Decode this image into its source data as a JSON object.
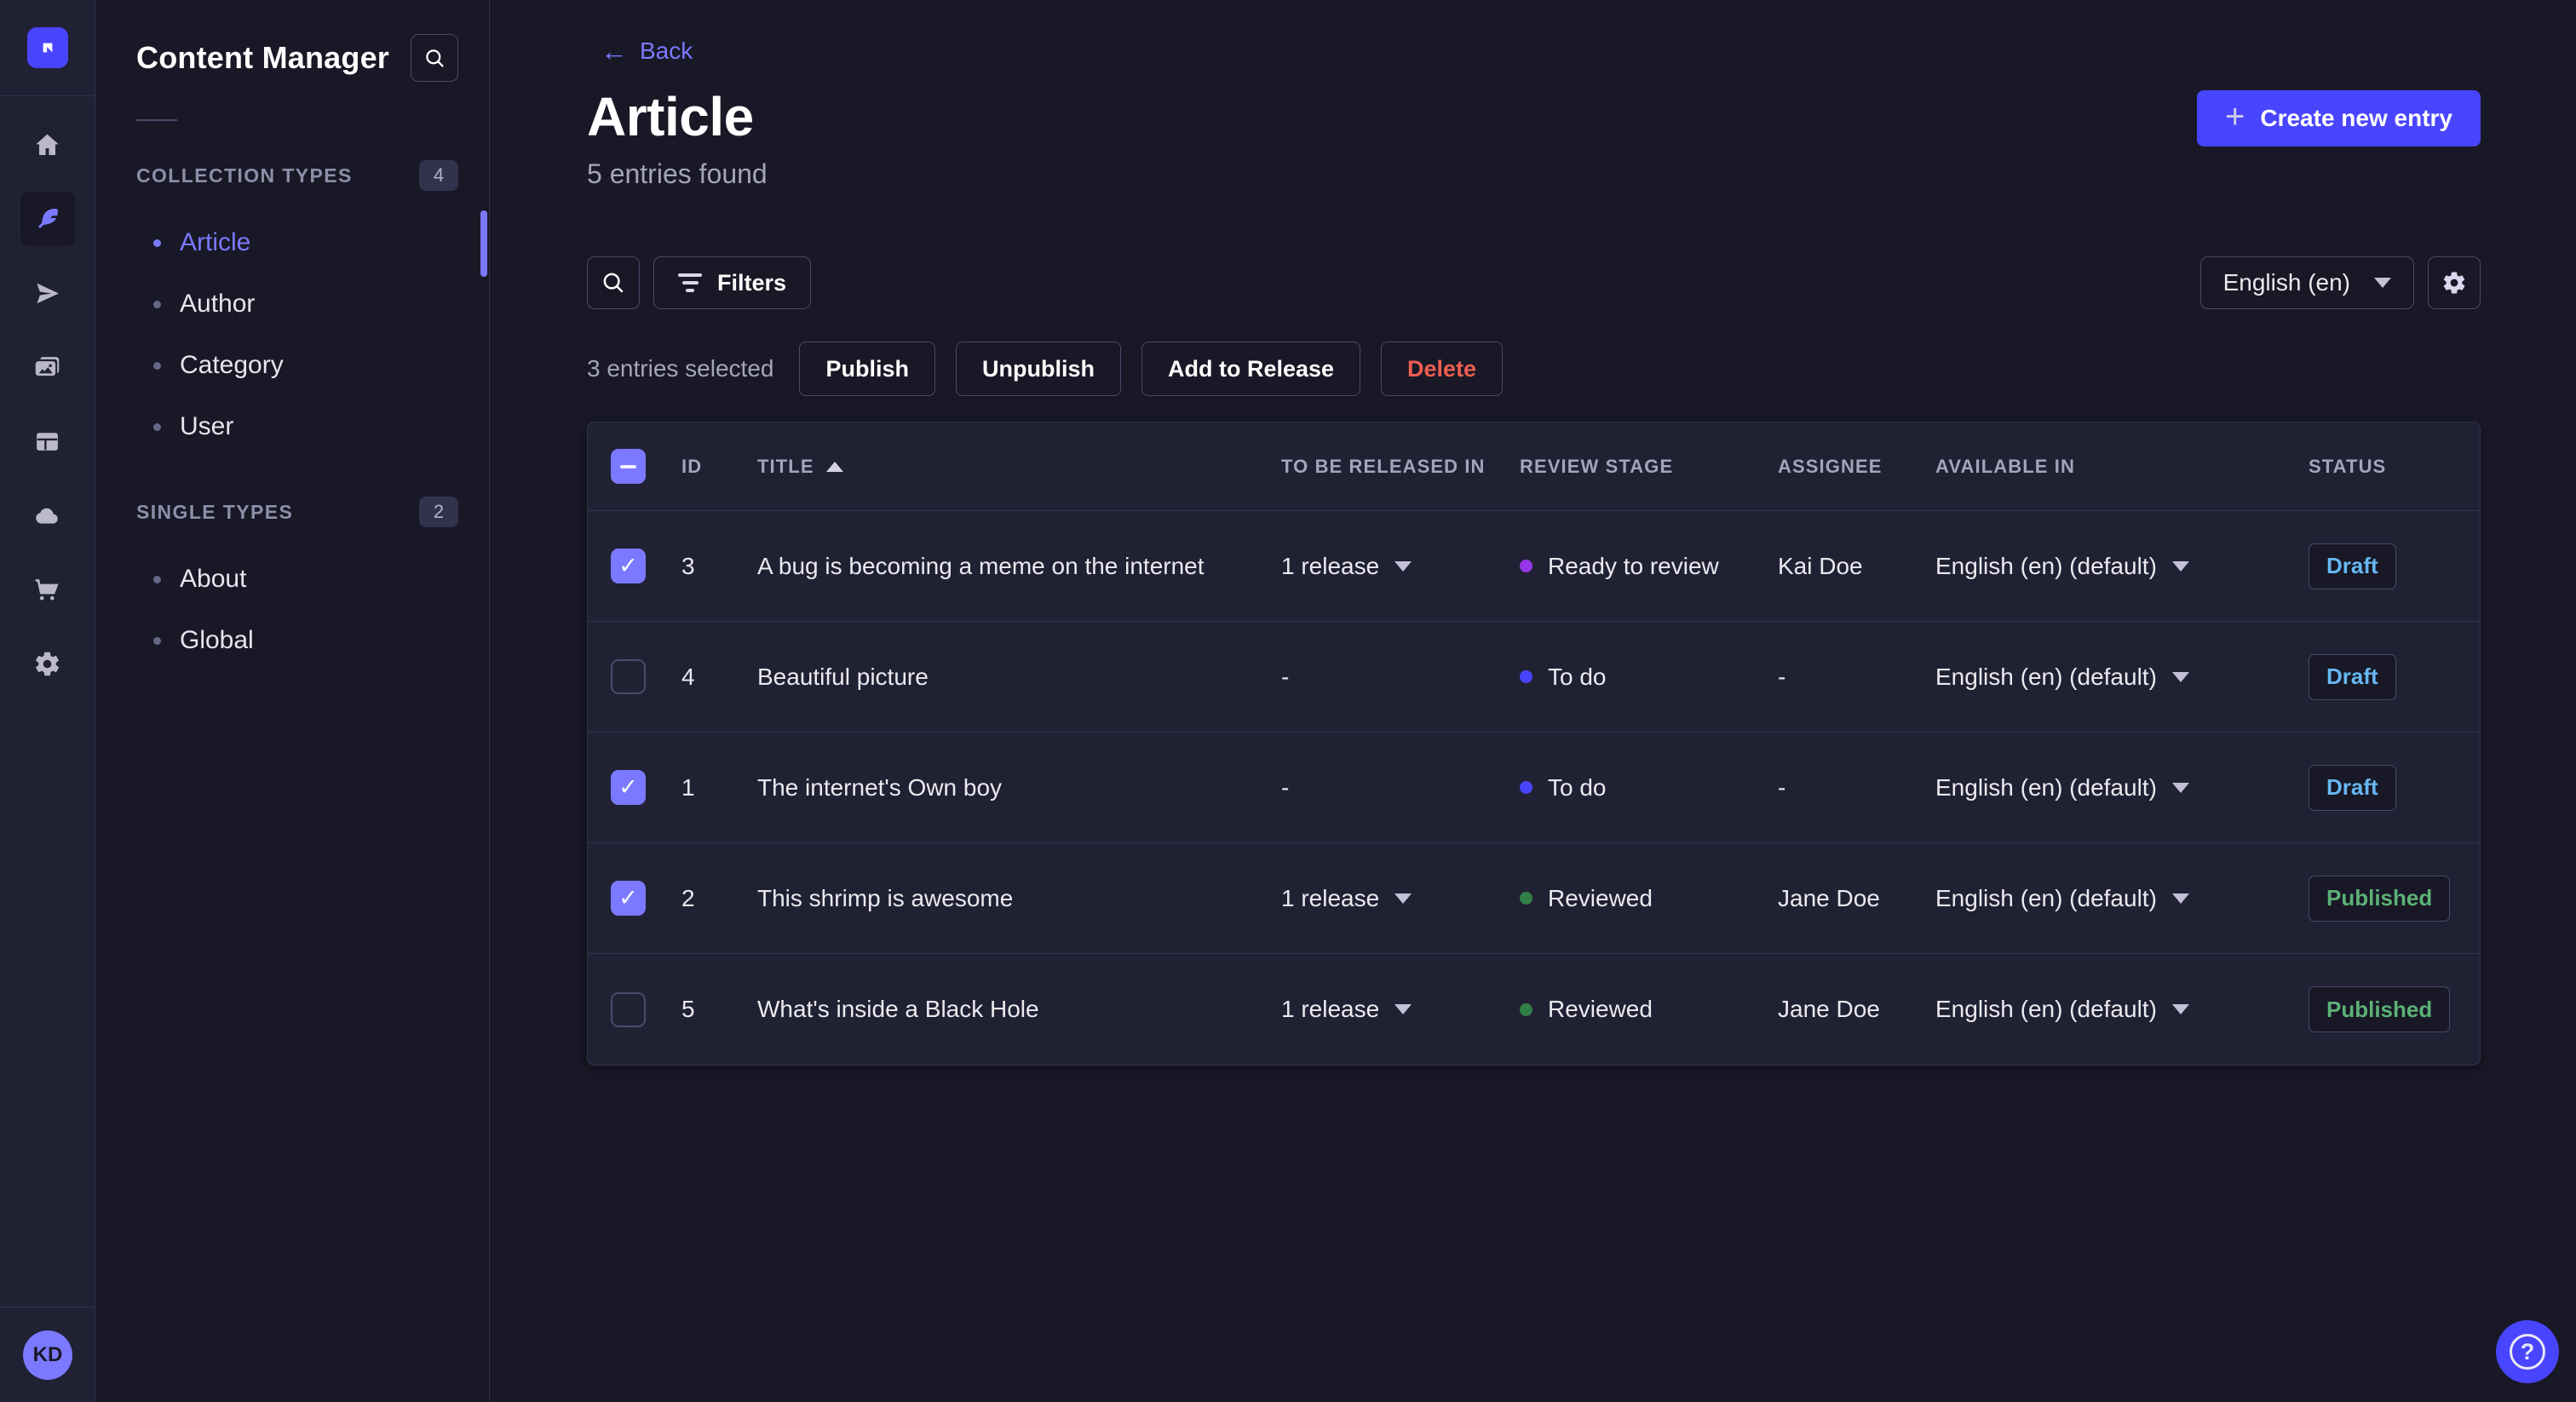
{
  "app": {
    "initials": "KD",
    "help_glyph": "?"
  },
  "rail": {
    "items": [
      {
        "name": "home",
        "icon": "home-icon",
        "active": false
      },
      {
        "name": "content-manager",
        "icon": "feather-icon",
        "active": true
      },
      {
        "name": "releases",
        "icon": "paper-plane-icon",
        "active": false
      },
      {
        "name": "media-library",
        "icon": "images-icon",
        "active": false
      },
      {
        "name": "content-type-builder",
        "icon": "layout-icon",
        "active": false
      },
      {
        "name": "deploy",
        "icon": "cloud-icon",
        "active": false
      },
      {
        "name": "marketplace",
        "icon": "cart-icon",
        "active": false
      },
      {
        "name": "settings",
        "icon": "gear-icon",
        "active": false
      }
    ]
  },
  "subnav": {
    "title": "Content Manager",
    "sections": [
      {
        "label": "COLLECTION TYPES",
        "badge": "4",
        "items": [
          {
            "label": "Article",
            "active": true
          },
          {
            "label": "Author",
            "active": false
          },
          {
            "label": "Category",
            "active": false
          },
          {
            "label": "User",
            "active": false
          }
        ]
      },
      {
        "label": "SINGLE TYPES",
        "badge": "2",
        "items": [
          {
            "label": "About",
            "active": false
          },
          {
            "label": "Global",
            "active": false
          }
        ]
      }
    ]
  },
  "header": {
    "back_label": "Back",
    "title": "Article",
    "subtitle": "5 entries found",
    "create_label": "Create new entry"
  },
  "toolbar": {
    "filters_label": "Filters",
    "locale": "English (en)"
  },
  "selection": {
    "text": "3 entries selected",
    "actions": [
      {
        "label": "Publish",
        "variant": "default"
      },
      {
        "label": "Unpublish",
        "variant": "default"
      },
      {
        "label": "Add to Release",
        "variant": "default"
      },
      {
        "label": "Delete",
        "variant": "danger"
      }
    ]
  },
  "table": {
    "columns": [
      "ID",
      "TITLE",
      "TO BE RELEASED IN",
      "REVIEW STAGE",
      "ASSIGNEE",
      "AVAILABLE IN",
      "STATUS"
    ],
    "sorted_column": "TITLE",
    "rows": [
      {
        "checked": true,
        "id": "3",
        "title": "A bug is becoming a meme on the internet",
        "release": "1 release",
        "review_stage": "Ready to review",
        "review_color": "#9736e8",
        "assignee": "Kai Doe",
        "available_in": "English (en) (default)",
        "status": "Draft",
        "status_color": "#66b7f1"
      },
      {
        "checked": false,
        "id": "4",
        "title": "Beautiful picture",
        "release": "-",
        "review_stage": "To do",
        "review_color": "#4945ff",
        "assignee": "-",
        "available_in": "English (en) (default)",
        "status": "Draft",
        "status_color": "#66b7f1"
      },
      {
        "checked": true,
        "id": "1",
        "title": "The internet's Own boy",
        "release": "-",
        "review_stage": "To do",
        "review_color": "#4945ff",
        "assignee": "-",
        "available_in": "English (en) (default)",
        "status": "Draft",
        "status_color": "#66b7f1"
      },
      {
        "checked": true,
        "id": "2",
        "title": "This shrimp is awesome",
        "release": "1 release",
        "review_stage": "Reviewed",
        "review_color": "#328048",
        "assignee": "Jane Doe",
        "available_in": "English (en) (default)",
        "status": "Published",
        "status_color": "#5cb176"
      },
      {
        "checked": false,
        "id": "5",
        "title": "What's inside a Black Hole",
        "release": "1 release",
        "review_stage": "Reviewed",
        "review_color": "#328048",
        "assignee": "Jane Doe",
        "available_in": "English (en) (default)",
        "status": "Published",
        "status_color": "#5cb176"
      }
    ]
  },
  "colors": {
    "primary": "#4945ff",
    "primary_light": "#7b79ff",
    "danger": "#ee5e52",
    "success": "#5cb176",
    "info": "#66b7f1"
  }
}
